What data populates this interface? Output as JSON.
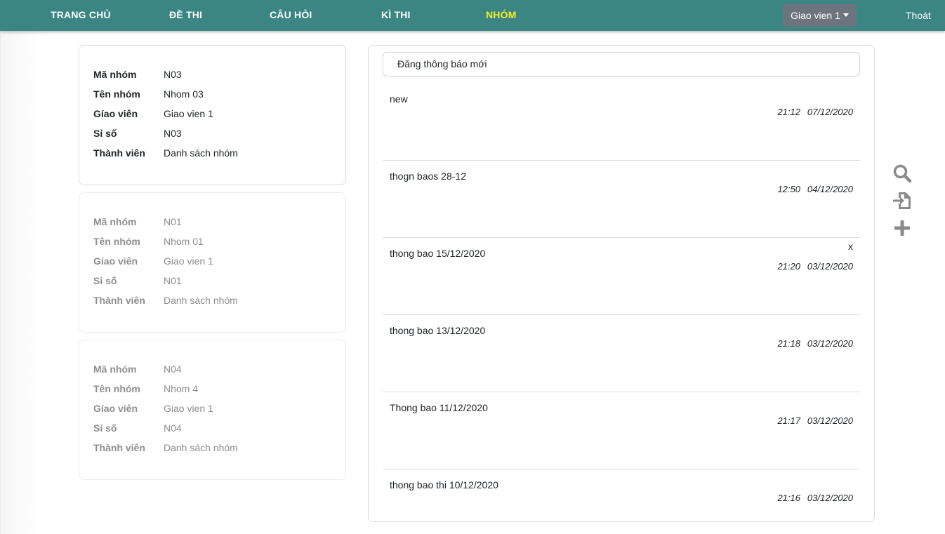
{
  "navbar": {
    "items": [
      {
        "label": "TRANG CHỦ"
      },
      {
        "label": "ĐỀ THI"
      },
      {
        "label": "CÂU HỎI"
      },
      {
        "label": "KÌ THI"
      },
      {
        "label": "NHÓM"
      }
    ],
    "active_item": "NHÓM",
    "user_menu": "Giao vien 1",
    "logout": "Thoát",
    "colors": {
      "bar": "#3b8583",
      "active": "#f5ee2b"
    }
  },
  "field_labels": {
    "code": "Mã nhóm",
    "name": "Tên nhóm",
    "teacher": "Gíao viên",
    "size": "Sỉ số",
    "members": "Thành viên"
  },
  "groups": [
    {
      "code": "N03",
      "name": "Nhom 03",
      "teacher": "Giao vien 1",
      "size": "N03",
      "members": "Danh sách nhóm",
      "selected": true
    },
    {
      "code": "N01",
      "name": "Nhom 01",
      "teacher": "Giao vien 1",
      "size": "N01",
      "members": "Danh sách nhóm",
      "selected": false
    },
    {
      "code": "N04",
      "name": "Nhom 4",
      "teacher": "Giao vien 1",
      "size": "N04",
      "members": "Danh sách nhóm",
      "selected": false
    }
  ],
  "announcements": {
    "new_post_placeholder": "Đăng thông báo mới",
    "delete_label": "x",
    "items": [
      {
        "text": "new",
        "time": "21:12",
        "date": "07/12/2020"
      },
      {
        "text": "thogn baos 28-12",
        "time": "12:50",
        "date": "04/12/2020"
      },
      {
        "text": "thong bao 15/12/2020",
        "time": "21:20",
        "date": "03/12/2020"
      },
      {
        "text": "thong bao 13/12/2020",
        "time": "21:18",
        "date": "03/12/2020"
      },
      {
        "text": "Thong bao 11/12/2020",
        "time": "21:17",
        "date": "03/12/2020"
      },
      {
        "text": "thong bao thi 10/12/2020",
        "time": "21:16",
        "date": "03/12/2020"
      }
    ]
  },
  "tools": [
    "search-icon",
    "import-file-icon",
    "add-icon"
  ]
}
